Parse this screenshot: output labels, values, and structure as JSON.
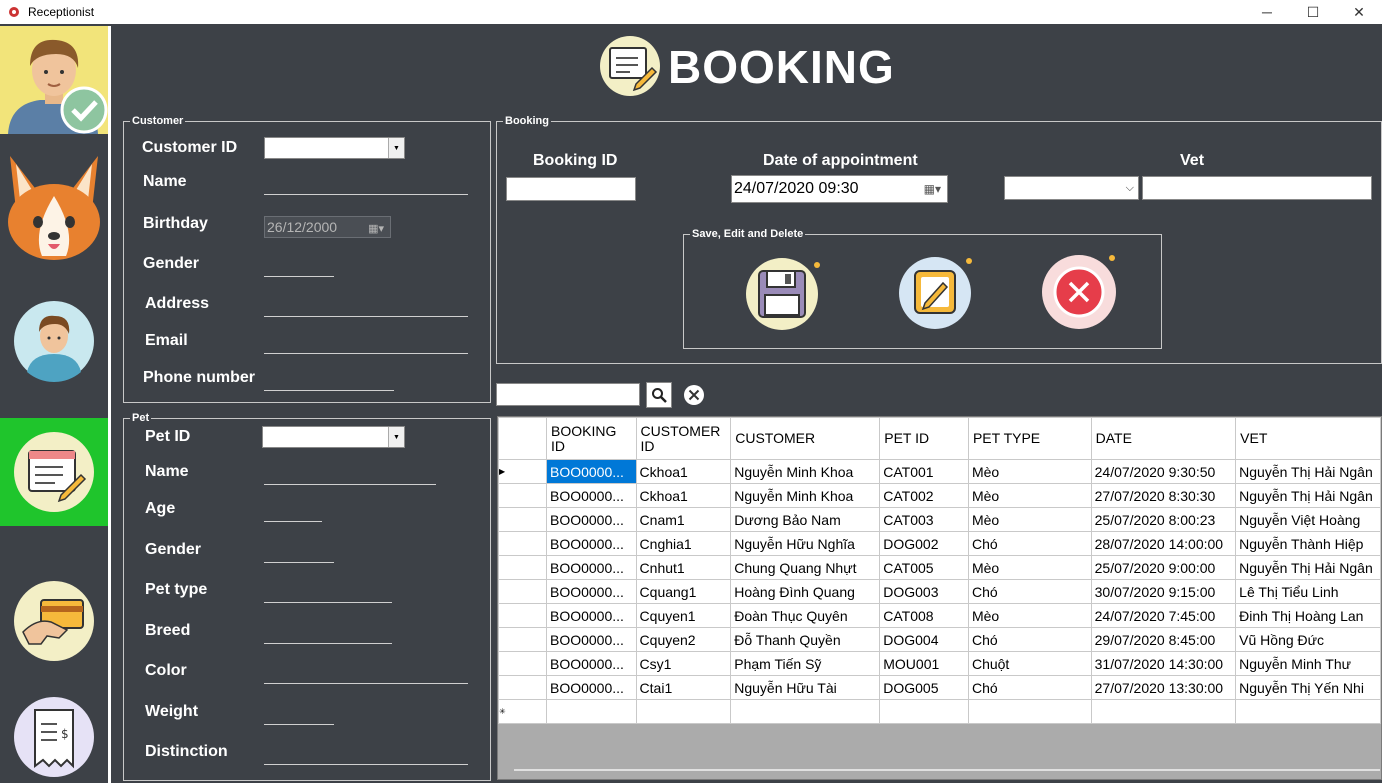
{
  "window": {
    "title": "Receptionist"
  },
  "header": {
    "title": "BOOKING"
  },
  "customer": {
    "legend": "Customer",
    "customer_id_label": "Customer ID",
    "name_label": "Name",
    "birthday_label": "Birthday",
    "birthday_value": "26/12/2000",
    "gender_label": "Gender",
    "address_label": "Address",
    "email_label": "Email",
    "phone_label": "Phone number"
  },
  "pet": {
    "legend": "Pet",
    "pet_id_label": "Pet ID",
    "name_label": "Name",
    "age_label": "Age",
    "gender_label": "Gender",
    "pet_type_label": "Pet type",
    "breed_label": "Breed",
    "color_label": "Color",
    "weight_label": "Weight",
    "distinction_label": "Distinction"
  },
  "booking": {
    "legend": "Booking",
    "booking_id_label": "Booking ID",
    "date_label": "Date of appointment",
    "date_value": "24/07/2020 09:30",
    "vet_label": "Vet",
    "actions_legend": "Save, Edit and Delete"
  },
  "grid": {
    "columns": [
      "BOOKING ID",
      "CUSTOMER ID",
      "CUSTOMER",
      "PET ID",
      "PET TYPE",
      "DATE",
      "VET"
    ],
    "rows": [
      [
        "BOO0000...",
        "Ckhoa1",
        "Nguyễn Minh Khoa",
        "CAT001",
        "Mèo",
        "24/07/2020 9:30:50",
        "Nguyễn Thị Hải Ngân"
      ],
      [
        "BOO0000...",
        "Ckhoa1",
        "Nguyễn Minh Khoa",
        "CAT002",
        "Mèo",
        "27/07/2020 8:30:30",
        "Nguyễn Thị Hải Ngân"
      ],
      [
        "BOO0000...",
        "Cnam1",
        "Dương Bảo Nam",
        "CAT003",
        "Mèo",
        "25/07/2020 8:00:23",
        "Nguyễn Việt Hoàng"
      ],
      [
        "BOO0000...",
        "Cnghia1",
        "Nguyễn Hữu Nghĩa",
        "DOG002",
        "Chó",
        "28/07/2020 14:00:00",
        "Nguyễn Thành Hiệp"
      ],
      [
        "BOO0000...",
        "Cnhut1",
        "Chung Quang Nhựt",
        "CAT005",
        "Mèo",
        "25/07/2020 9:00:00",
        "Nguyễn Thị Hải Ngân"
      ],
      [
        "BOO0000...",
        "Cquang1",
        "Hoàng Đình Quang",
        "DOG003",
        "Chó",
        "30/07/2020 9:15:00",
        "Lê Thị Tiểu Linh"
      ],
      [
        "BOO0000...",
        "Cquyen1",
        "Đoàn Thục Quyên",
        "CAT008",
        "Mèo",
        "24/07/2020 7:45:00",
        "Đinh Thị Hoàng Lan"
      ],
      [
        "BOO0000...",
        "Cquyen2",
        "Đỗ Thanh Quyền",
        "DOG004",
        "Chó",
        "29/07/2020 8:45:00",
        "Vũ Hồng Đức"
      ],
      [
        "BOO0000...",
        "Csy1",
        "Phạm Tiến Sỹ",
        "MOU001",
        "Chuột",
        "31/07/2020 14:30:00",
        "Nguyễn Minh Thư"
      ],
      [
        "BOO0000...",
        "Ctai1",
        "Nguyễn Hữu Tài",
        "DOG005",
        "Chó",
        "27/07/2020 13:30:00",
        "Nguyễn Thị Yến Nhi"
      ]
    ]
  },
  "colors": {
    "background": "#3d4147",
    "active_nav": "#1fc52c",
    "profile_bg": "#f2e47a",
    "selection": "#0078d7"
  }
}
